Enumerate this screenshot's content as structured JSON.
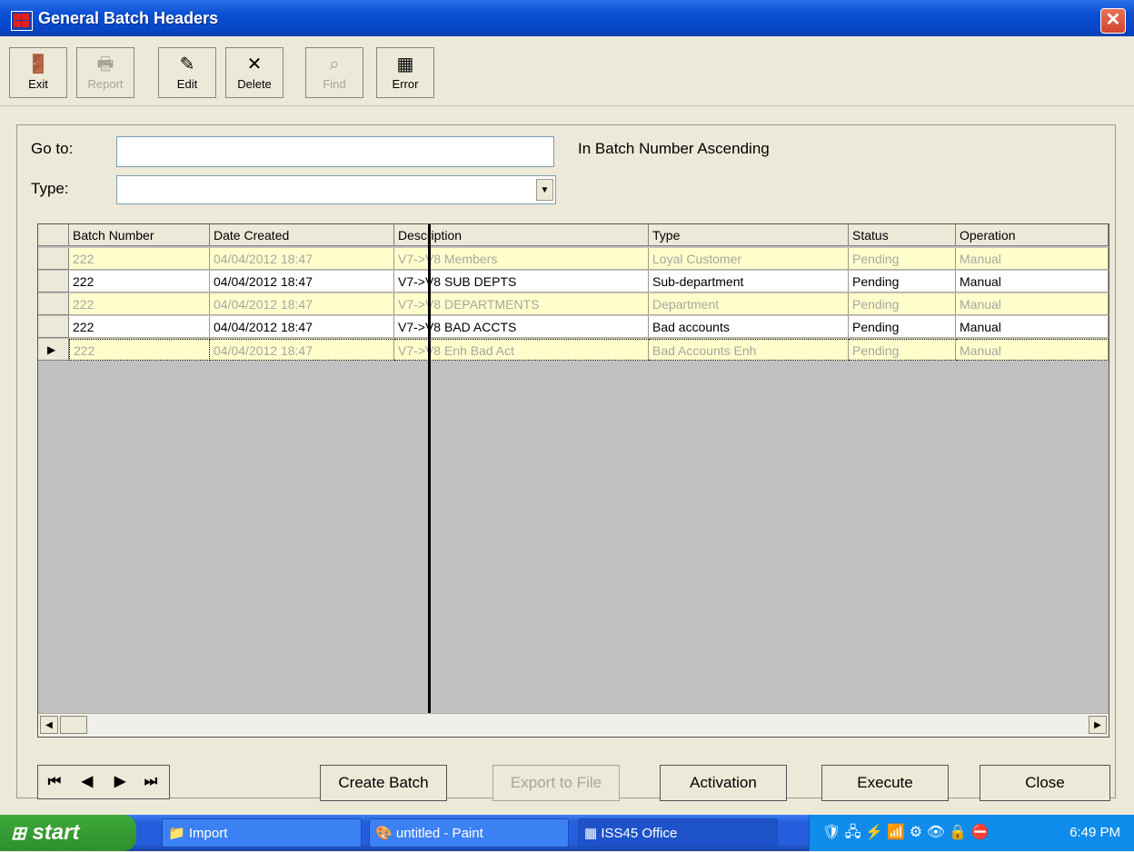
{
  "window": {
    "title": "General Batch Headers",
    "close_glyph": "✕"
  },
  "toolbar": [
    {
      "label": "Exit",
      "icon": "exit-door-icon",
      "glyph": "🚪",
      "enabled": true
    },
    {
      "label": "Report",
      "icon": "printer-icon",
      "glyph": "🖶",
      "enabled": false
    },
    {
      "label": "Edit",
      "icon": "edit-icon",
      "glyph": "✎",
      "enabled": true
    },
    {
      "label": "Delete",
      "icon": "delete-x-icon",
      "glyph": "✕",
      "enabled": true
    },
    {
      "label": "Find",
      "icon": "binoculars-icon",
      "glyph": "⌕",
      "enabled": false
    },
    {
      "label": "Error",
      "icon": "grid-table-icon",
      "glyph": "▦",
      "enabled": true
    }
  ],
  "form": {
    "goto_label": "Go to:",
    "goto_value": "",
    "sort_text": "In Batch Number Ascending",
    "type_label": "Type:",
    "type_value": ""
  },
  "grid": {
    "columns": [
      "Batch Number",
      "Date Created",
      "Description",
      "Type",
      "Status",
      "Operation"
    ],
    "rows": [
      [
        "222",
        "04/04/2012 18:47",
        "V7->V8 Members",
        "Loyal Customer",
        "Pending",
        "Manual"
      ],
      [
        "222",
        "04/04/2012 18:47",
        "V7->V8 SUB DEPTS",
        "Sub-department",
        "Pending",
        "Manual"
      ],
      [
        "222",
        "04/04/2012 18:47",
        "V7->V8 DEPARTMENTS",
        "Department",
        "Pending",
        "Manual"
      ],
      [
        "222",
        "04/04/2012 18:47",
        "V7->V8 BAD ACCTS",
        "Bad accounts",
        "Pending",
        "Manual"
      ],
      [
        "222",
        "04/04/2012 18:47",
        "V7->V8 Enh Bad Act",
        "Bad Accounts Enh",
        "Pending",
        "Manual"
      ]
    ],
    "current_row_marker": "▶"
  },
  "nav": {
    "first": "⏮",
    "prev": "◀",
    "next": "▶",
    "last": "⏭"
  },
  "buttons": {
    "create_batch": "Create Batch",
    "export_to_file": "Export to File",
    "activation": "Activation",
    "execute": "Execute",
    "close": "Close"
  },
  "taskbar": {
    "start": "start",
    "tasks": [
      "Import",
      "untitled - Paint",
      "ISS45 Office"
    ],
    "clock": "6:49 PM"
  },
  "colors": {
    "title_blue": "#0a4fd4",
    "row_highlight": "#ffffcc",
    "taskbar_blue": "#245edc",
    "start_green": "#3da83a"
  }
}
